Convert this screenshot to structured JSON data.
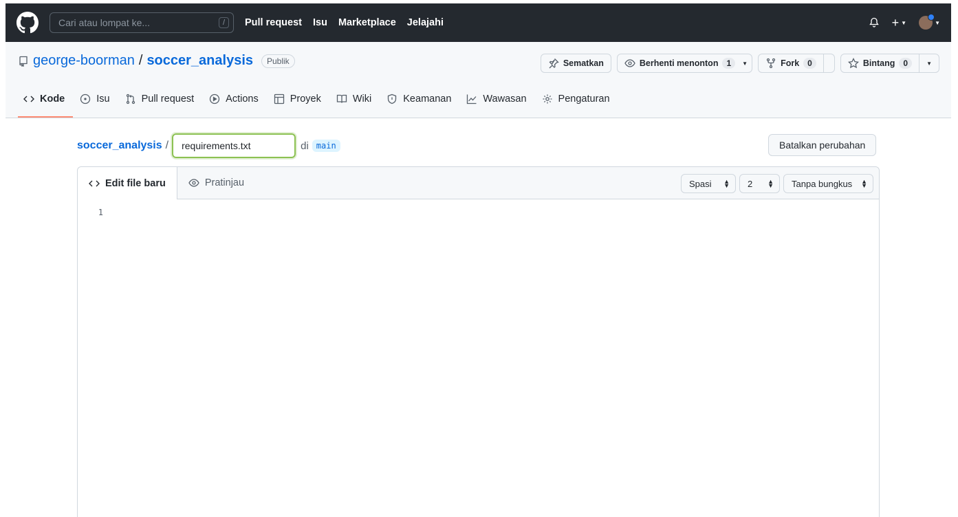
{
  "header": {
    "search_placeholder": "Cari atau lompat ke...",
    "search_shortcut": "/",
    "nav": [
      "Pull request",
      "Isu",
      "Marketplace",
      "Jelajahi"
    ]
  },
  "repo": {
    "owner": "george-boorman",
    "separator": "/",
    "name": "soccer_analysis",
    "visibility": "Publik",
    "pin_label": "Sematkan",
    "watch_label": "Berhenti menonton",
    "watch_count": "1",
    "fork_label": "Fork",
    "fork_count": "0",
    "star_label": "Bintang",
    "star_count": "0"
  },
  "tabs": [
    "Kode",
    "Isu",
    "Pull request",
    "Actions",
    "Proyek",
    "Wiki",
    "Keamanan",
    "Wawasan",
    "Pengaturan"
  ],
  "editor": {
    "breadcrumb_repo": "soccer_analysis",
    "breadcrumb_sep": "/",
    "filename": "requirements.txt",
    "in_label": "di",
    "branch": "main",
    "cancel_label": "Batalkan perubahan",
    "tab_edit": "Edit file baru",
    "tab_preview": "Pratinjau",
    "indent_mode": "Spasi",
    "indent_size": "2",
    "wrap_mode": "Tanpa bungkus",
    "line_numbers": [
      "1"
    ]
  }
}
